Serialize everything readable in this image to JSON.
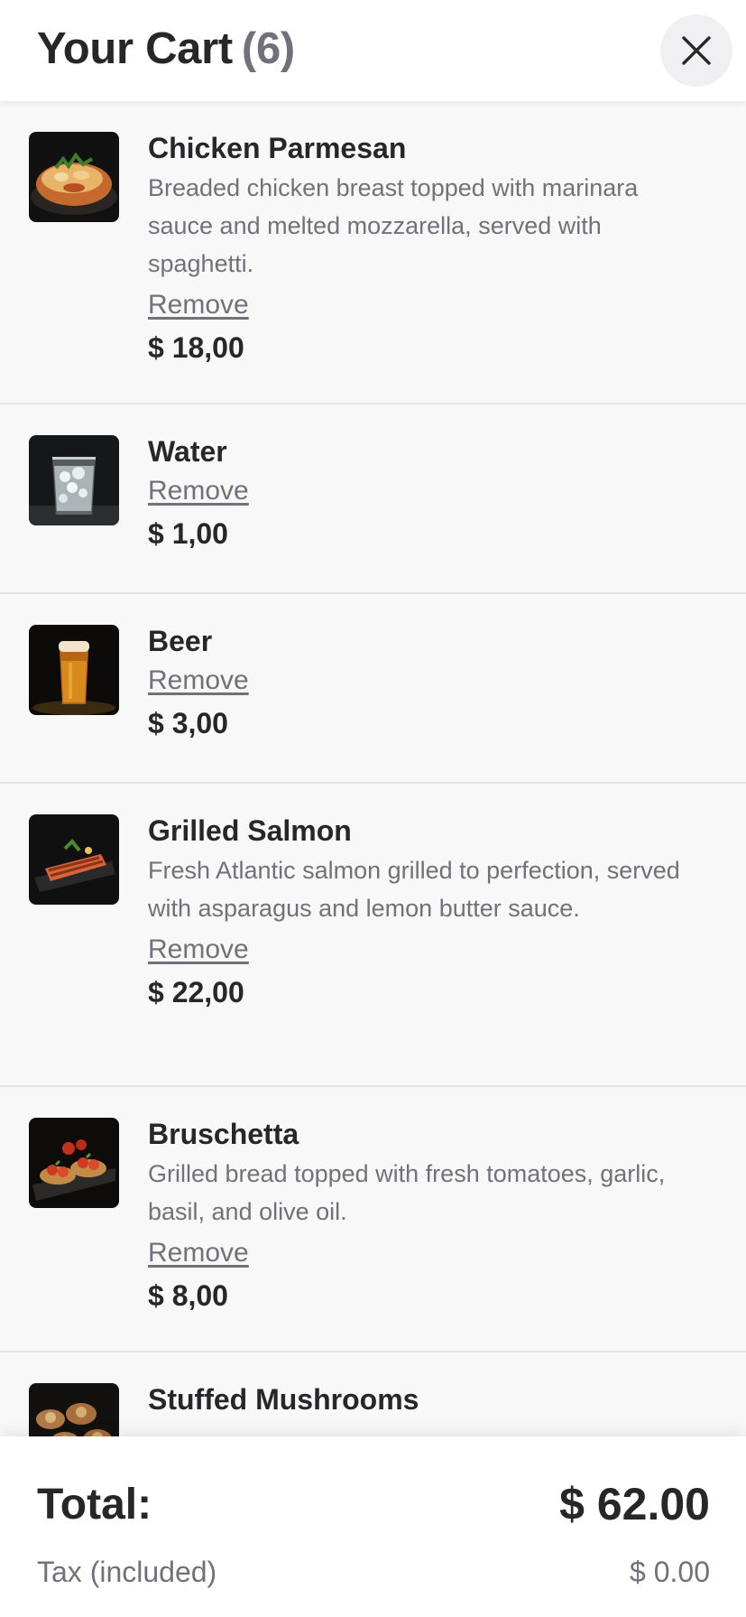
{
  "header": {
    "title": "Your Cart",
    "count": "(6)",
    "close_icon": "close-icon"
  },
  "items": [
    {
      "name": "Chicken Parmesan",
      "description": "Breaded chicken breast topped with marinara sauce and melted mozzarella, served with spaghetti.",
      "remove_label": "Remove",
      "price": "$ 18,00",
      "image_icon": "chicken-parmesan-photo"
    },
    {
      "name": "Water",
      "description": "",
      "remove_label": "Remove",
      "price": "$ 1,00",
      "image_icon": "water-glass-photo"
    },
    {
      "name": "Beer",
      "description": "",
      "remove_label": "Remove",
      "price": "$ 3,00",
      "image_icon": "beer-glass-photo"
    },
    {
      "name": "Grilled Salmon",
      "description": "Fresh Atlantic salmon grilled to perfection, served with asparagus and lemon butter sauce.",
      "remove_label": "Remove",
      "price": "$ 22,00",
      "image_icon": "grilled-salmon-photo"
    },
    {
      "name": "Bruschetta",
      "description": "Grilled bread topped with fresh tomatoes, garlic, basil, and olive oil.",
      "remove_label": "Remove",
      "price": "$ 8,00",
      "image_icon": "bruschetta-photo"
    },
    {
      "name": "Stuffed Mushrooms",
      "description": "",
      "remove_label": "",
      "price": "",
      "image_icon": "stuffed-mushrooms-photo"
    }
  ],
  "footer": {
    "total_label": "Total:",
    "total_value": "$ 62.00",
    "tax_label": "Tax (included)",
    "tax_value": "$ 0.00"
  },
  "colors": {
    "text_primary": "#27272a",
    "text_muted": "#71717a",
    "list_background": "#f8f8f9",
    "divider": "#e4e4e7"
  }
}
